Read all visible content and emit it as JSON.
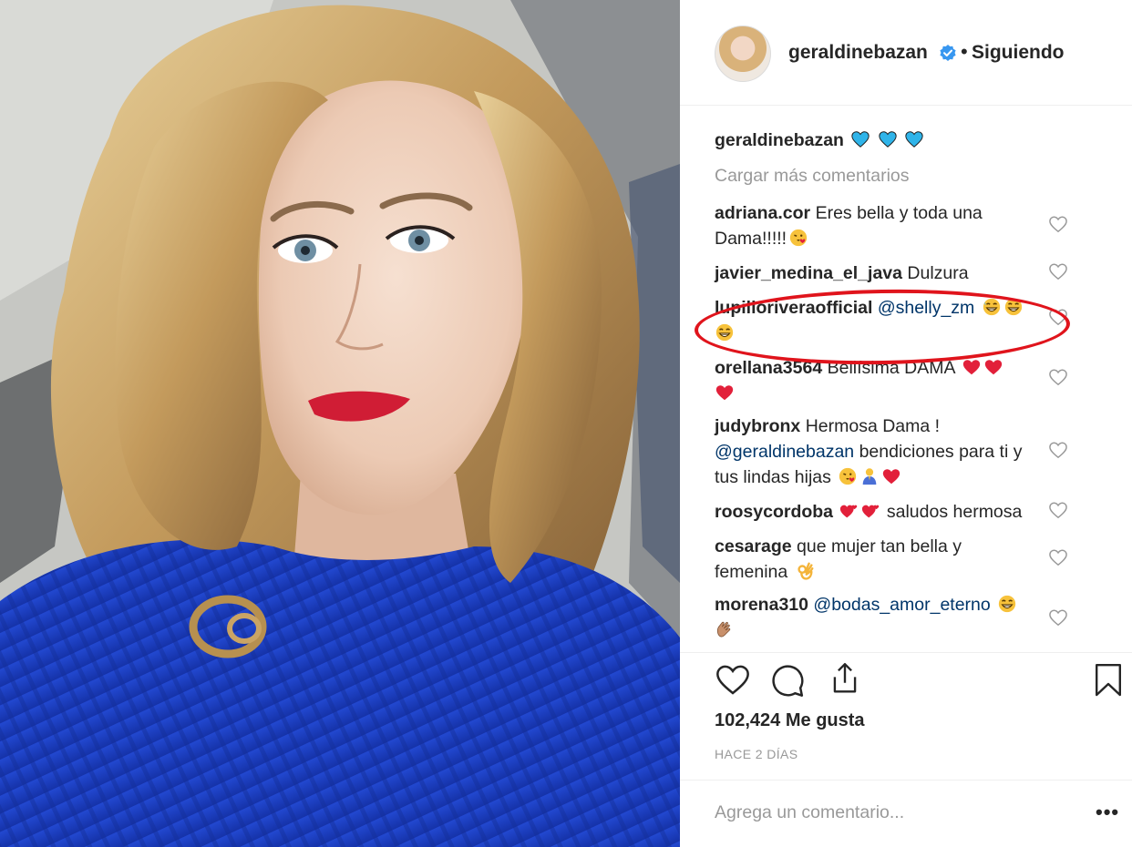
{
  "post": {
    "author": "geraldinebazan",
    "follow_status": "Siguiendo",
    "separator": "•",
    "verified": true,
    "caption_user": "geraldinebazan",
    "caption_icons": [
      "blue-heart-icon",
      "blue-heart-icon",
      "blue-heart-icon"
    ],
    "photo_alt": "selfie"
  },
  "load_more": "Cargar más comentarios",
  "comments": [
    {
      "user": "adriana.cor",
      "text": "Eres bella y toda una",
      "text2": "Dama!!!!!",
      "emoji": [
        "kiss-wink-icon"
      ]
    },
    {
      "user": "javier_medina_el_java",
      "text": "Dulzura",
      "emoji": []
    },
    {
      "user": "lupilloriveraofficial",
      "mention": "@shelly_zm",
      "emoji": [
        "grin-sweat-icon",
        "grin-sweat-icon",
        "grin-sweat-icon"
      ],
      "highlighted": true
    },
    {
      "user": "orellana3564",
      "text": "Bellísima DAMA",
      "emoji": [
        "red-heart-icon",
        "red-heart-icon",
        "red-heart-icon"
      ]
    },
    {
      "user": "judybronx",
      "text": "Hermosa Dama !",
      "mention": "@geraldinebazan",
      "text2": "bendiciones para ti y",
      "text3": "tus lindas hijas",
      "emoji": [
        "kiss-wink-icon",
        "praying-person-icon",
        "red-heart-icon"
      ]
    },
    {
      "user": "roosycordoba",
      "text": "saludos hermosa",
      "emoji": [
        "revolving-hearts-icon",
        "revolving-hearts-icon"
      ]
    },
    {
      "user": "cesarage",
      "text": "que mujer tan bella y",
      "text2": "femenina",
      "emoji": [
        "ok-hand-icon"
      ]
    },
    {
      "user": "morena310",
      "mention": "@bodas_amor_eterno",
      "emoji": [
        "grin-sweat-icon",
        "clapping-hands-icon"
      ]
    }
  ],
  "likes": "102,424 Me gusta",
  "time_ago": "HACE 2 DÍAS",
  "add_comment": {
    "placeholder": "Agrega un comentario..."
  },
  "more_options": "•••",
  "colors": {
    "text": "#262626",
    "muted": "#999999",
    "mention": "#003569",
    "verified": "#3897f0",
    "highlight_circle": "#e0141c",
    "sweater": "#1c3fbf"
  }
}
